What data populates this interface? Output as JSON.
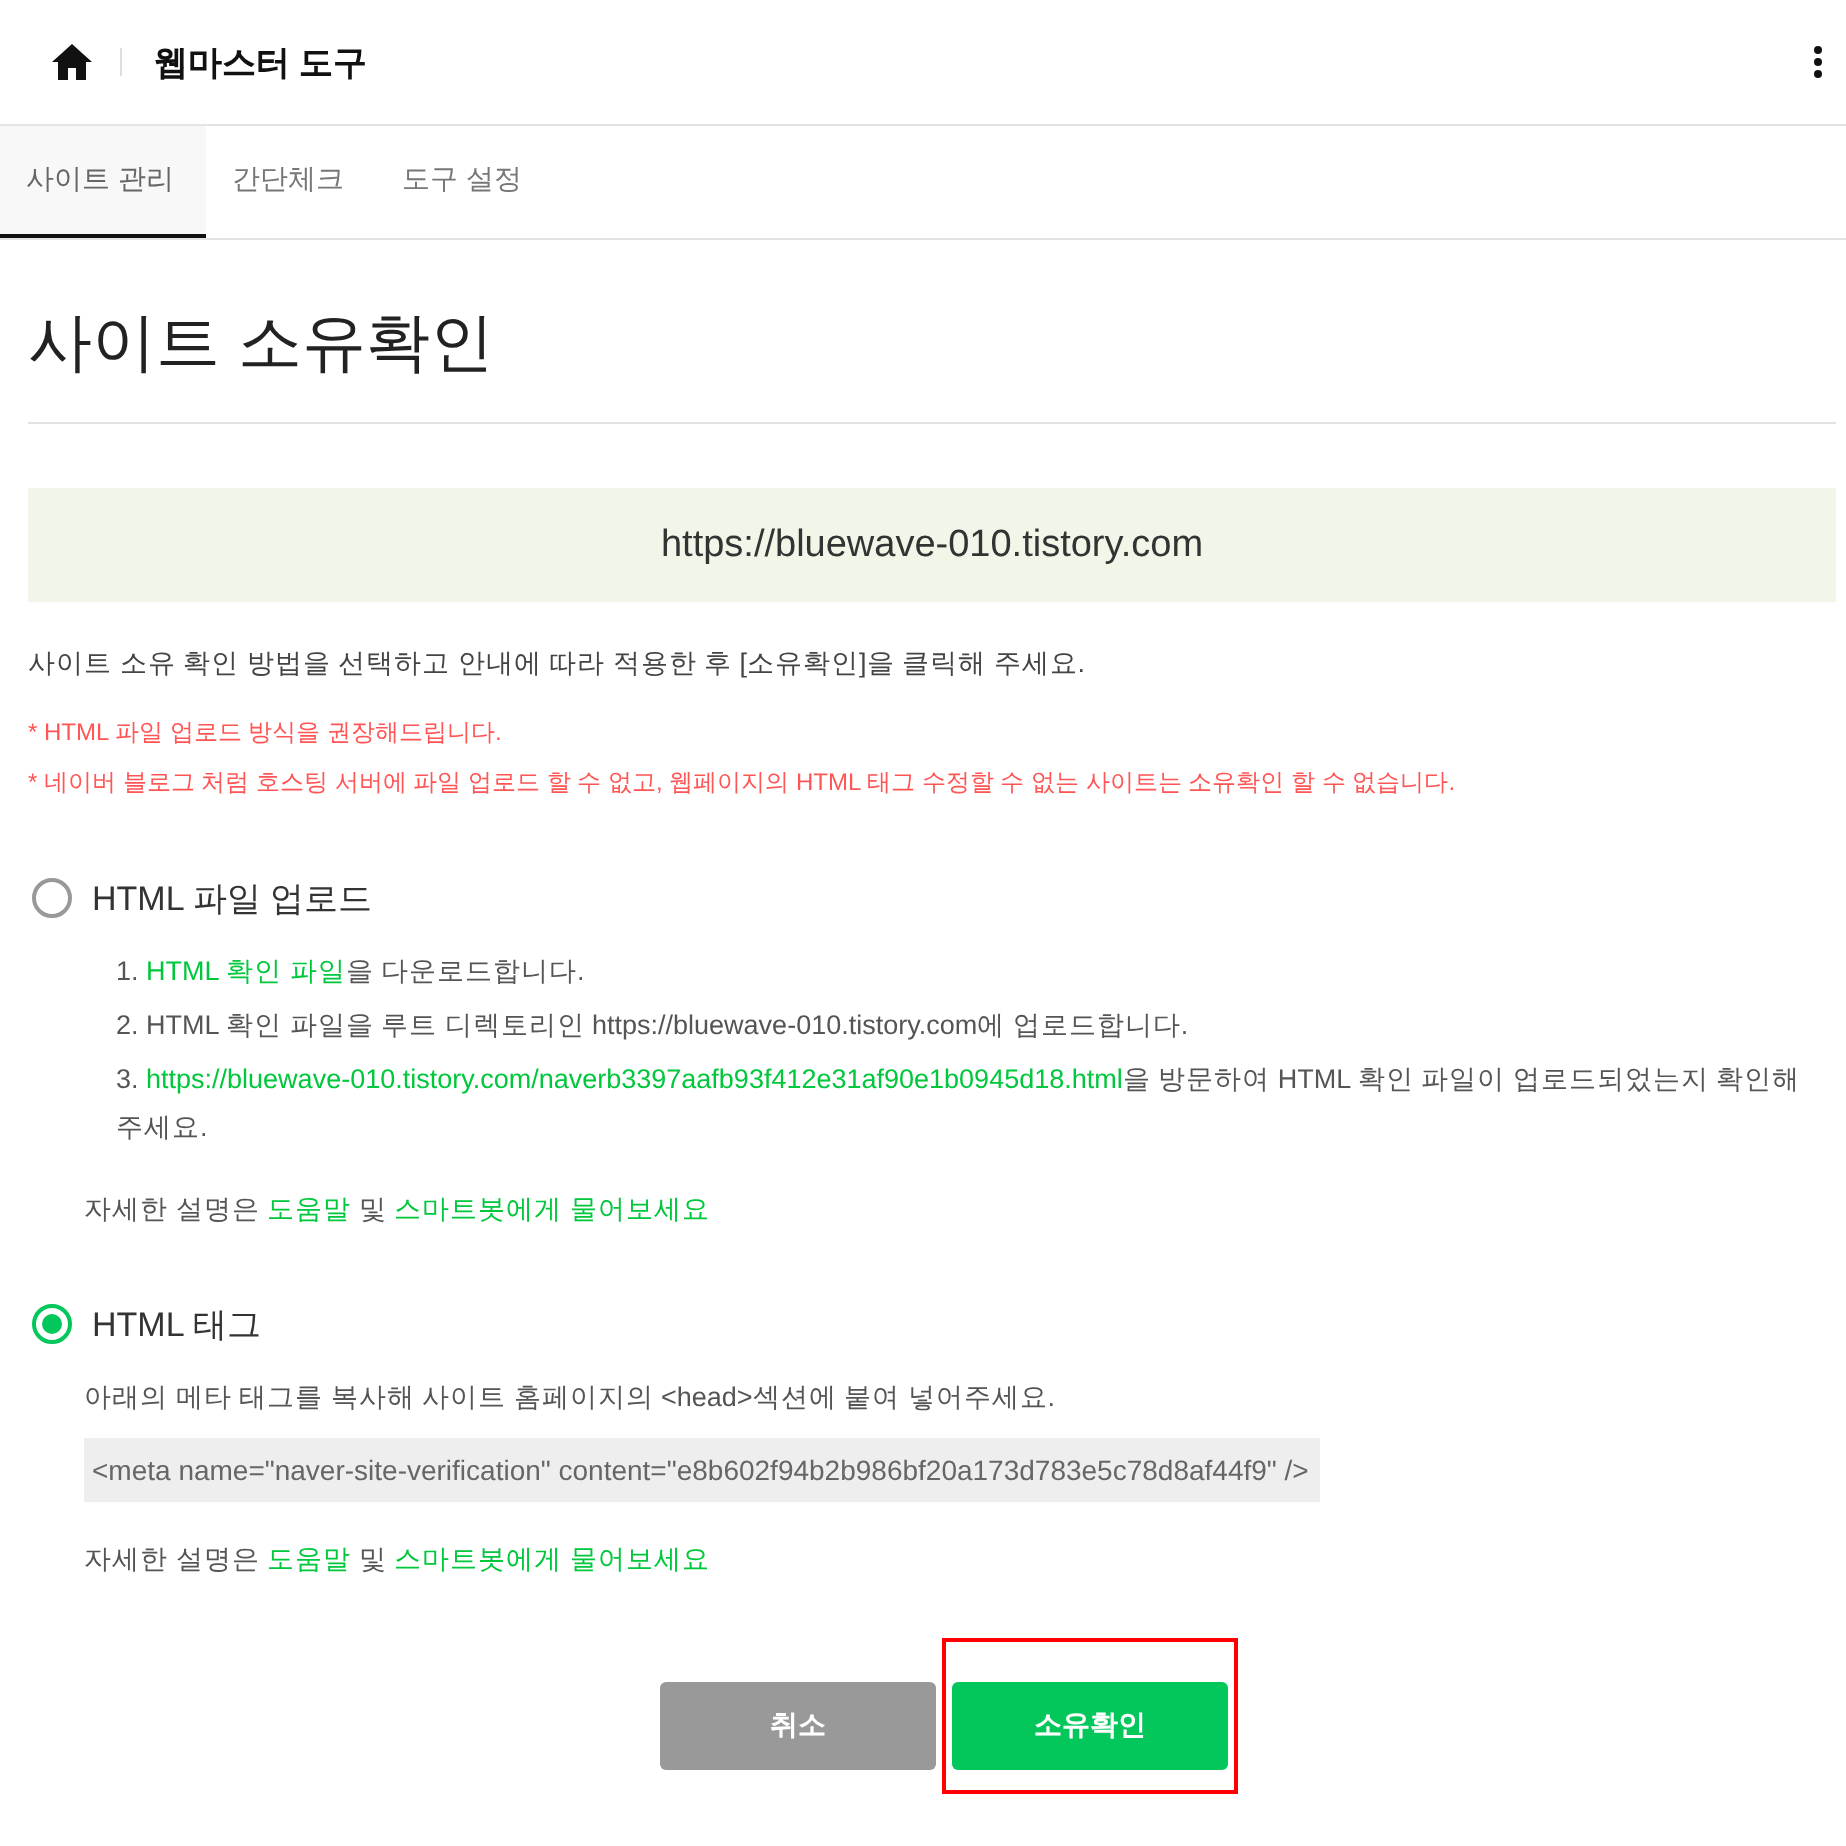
{
  "header": {
    "title": "웹마스터 도구"
  },
  "tabs": [
    {
      "label": "사이트 관리",
      "selected": true
    },
    {
      "label": "간단체크",
      "selected": false
    },
    {
      "label": "도구 설정",
      "selected": false
    }
  ],
  "page_title": "사이트 소유확인",
  "site_url": "https://bluewave-010.tistory.com",
  "instruction": "사이트 소유 확인 방법을 선택하고 안내에 따라 적용한 후 [소유확인]을 클릭해 주세요.",
  "notes": [
    "* HTML 파일 업로드 방식을 권장해드립니다.",
    "* 네이버 블로그 처럼 호스팅 서버에 파일 업로드 할 수 없고, 웹페이지의 HTML 태그 수정할 수 없는 사이트는 소유확인 할 수 없습니다."
  ],
  "methods": [
    {
      "kind": "file",
      "label": "HTML 파일 업로드",
      "selected": false,
      "steps": [
        [
          {
            "kind": "text",
            "text": "1. "
          },
          {
            "kind": "link",
            "text": "HTML 확인 파일"
          },
          {
            "kind": "text",
            "text": "을 다운로드합니다."
          }
        ],
        [
          {
            "kind": "text",
            "text": "2. HTML 확인 파일을 루트 디렉토리인 https://bluewave-010.tistory.com에 업로드합니다."
          }
        ],
        [
          {
            "kind": "text",
            "text": "3. "
          },
          {
            "kind": "link",
            "text": "https://bluewave-010.tistory.com/naverb3397aafb93f412e31af90e1b0945d18.html"
          },
          {
            "kind": "text",
            "text": "을 방문하여 HTML 확인 파일이 업로드되었는지 확인해 주세요."
          }
        ]
      ],
      "help": [
        {
          "kind": "text",
          "text": "자세한 설명은 "
        },
        {
          "kind": "link",
          "text": "도움말"
        },
        {
          "kind": "text",
          "text": " 및 "
        },
        {
          "kind": "link",
          "text": "스마트봇에게 물어보세요"
        }
      ]
    },
    {
      "kind": "tag",
      "label": "HTML 태그",
      "selected": true,
      "description": "아래의 메타 태그를 복사해 사이트 홈페이지의 <head>섹션에 붙여 넣어주세요.",
      "code": "<meta name=\"naver-site-verification\" content=\"e8b602f94b2b986bf20a173d783e5c78d8af44f9\" />",
      "help": [
        {
          "kind": "text",
          "text": "자세한 설명은 "
        },
        {
          "kind": "link",
          "text": "도움말"
        },
        {
          "kind": "text",
          "text": " 및 "
        },
        {
          "kind": "link",
          "text": "스마트봇에게 물어보세요"
        }
      ]
    }
  ],
  "buttons": [
    {
      "kind": "cancel",
      "label": "취소",
      "highlighted": false
    },
    {
      "kind": "confirm",
      "label": "소유확인",
      "highlighted": true
    }
  ]
}
